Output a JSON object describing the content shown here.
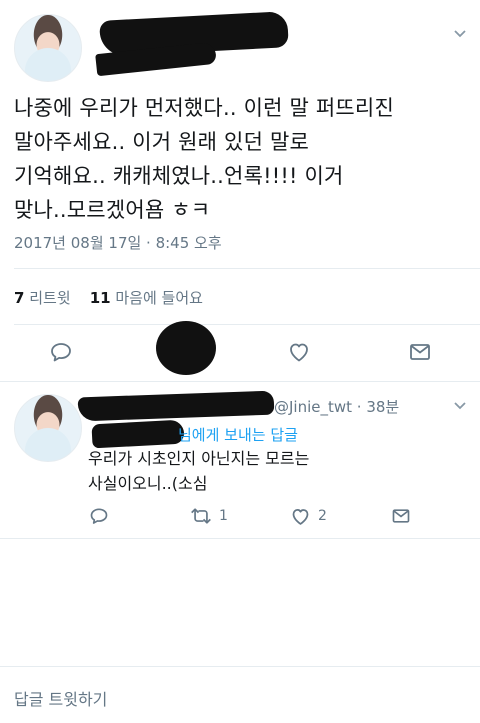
{
  "main_tweet": {
    "text_lines": [
      "나중에 우리가 먼저했다.. 이런 말 퍼뜨리진",
      "말아주세요.. 이거 원래 있던 말로",
      "기억해요.. 캐캐체였나..언록!!!! 이거",
      "맞나..모르겠어욤 ㅎㅋ"
    ],
    "timestamp": "2017년 08월 17일 · 8:45 오후",
    "retweet_count": "7",
    "retweet_label": "리트윗",
    "like_count": "11",
    "like_label": "마음에 들어요",
    "icons": [
      "reply-icon",
      "retweet-icon",
      "like-icon",
      "message-icon"
    ]
  },
  "reply_tweet": {
    "handle_time": "@Jinie_twt · 38분",
    "replying_to": "님에게 보내는 답글",
    "text_lines": [
      "우리가 시초인지 아닌지는 모르는",
      "사실이오니..(소심"
    ],
    "retweet_count": "1",
    "like_count": "2"
  },
  "compose": {
    "placeholder": "답글 트윗하기"
  },
  "colors": {
    "text": "#14171a",
    "secondary": "#657786",
    "link": "#1da1f2",
    "divider": "#e6ecf0"
  }
}
